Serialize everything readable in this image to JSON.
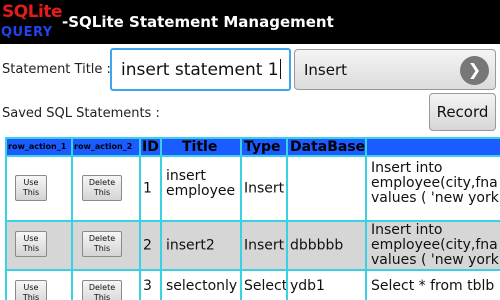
{
  "app": {
    "logo_top": "SQLite",
    "logo_bottom": "QUERY",
    "title": "-SQLite Statement Management"
  },
  "form": {
    "statement_title_label": "Statement Title :",
    "statement_title_value": "insert statement 1",
    "type_value": "Insert",
    "next_icon": "chevron-right-icon",
    "saved_label": "Saved SQL Statements :",
    "record_label": "Record"
  },
  "table": {
    "headers": [
      "row_action_1",
      "row_action_2",
      "ID",
      "Title",
      "Type",
      "DataBase"
    ],
    "use_label": "Use\nThis",
    "delete_label": "Delete\nThis",
    "rows": [
      {
        "id": "1",
        "title": "insert employee",
        "type": "Insert",
        "database": "",
        "statement": "Insert into employee(city,fna values ( 'new york"
      },
      {
        "id": "2",
        "title": "insert2",
        "type": "Insert",
        "database": "dbbbbb",
        "statement": "Insert into employee(city,fna values ( 'new york"
      },
      {
        "id": "3",
        "title": "selectonly",
        "type": "Select",
        "database": "ydb1",
        "statement": "Select * from tblb"
      }
    ]
  },
  "colors": {
    "titlebar": "#000000",
    "header_row": "#1a5cff",
    "grid_lines": "#3ad0e6",
    "row_alt": "#d6d6d6",
    "focus": "#3fa4ee"
  }
}
